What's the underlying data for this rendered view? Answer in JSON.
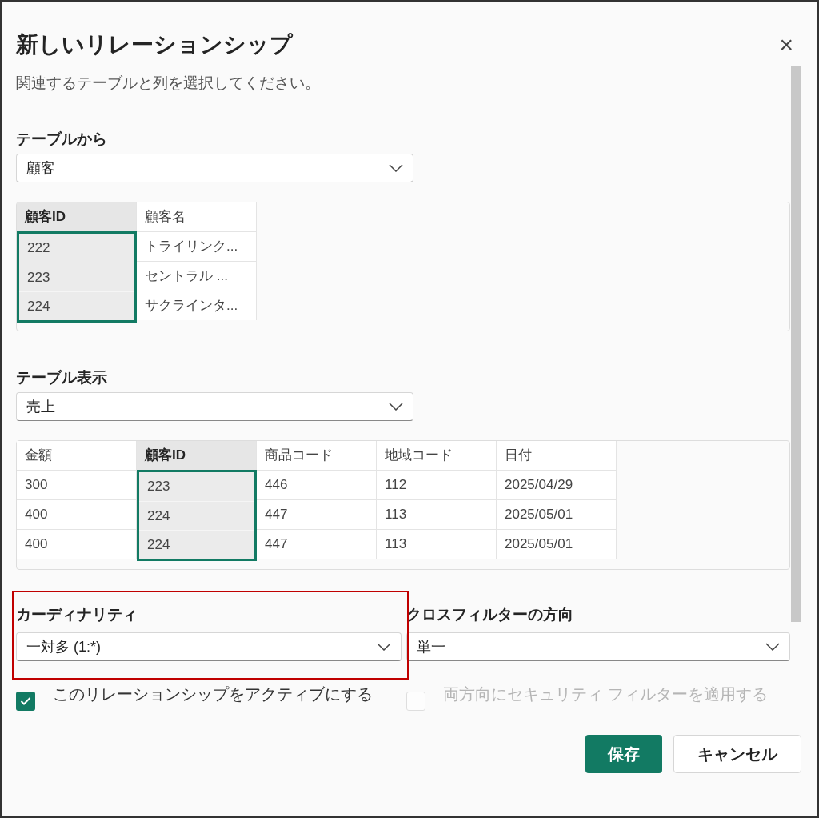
{
  "dialog": {
    "title": "新しいリレーションシップ",
    "subtitle": "関連するテーブルと列を選択してください。",
    "close": "×"
  },
  "from_table": {
    "label": "テーブルから",
    "dropdown": "顧客",
    "columns": [
      {
        "name": "顧客ID",
        "selected": true
      },
      {
        "name": "顧客名",
        "selected": false
      }
    ],
    "rows": [
      [
        "222",
        "トライリンク..."
      ],
      [
        "223",
        "セントラル ..."
      ],
      [
        "224",
        "サクラインタ..."
      ]
    ]
  },
  "to_table": {
    "label": "テーブル表示",
    "dropdown": "売上",
    "columns": [
      {
        "name": "金額",
        "selected": false
      },
      {
        "name": "顧客ID",
        "selected": true
      },
      {
        "name": "商品コード",
        "selected": false
      },
      {
        "name": "地域コード",
        "selected": false
      },
      {
        "name": "日付",
        "selected": false
      }
    ],
    "rows": [
      [
        "300",
        "223",
        "446",
        "112",
        "2025/04/29"
      ],
      [
        "400",
        "224",
        "447",
        "113",
        "2025/05/01"
      ],
      [
        "400",
        "224",
        "447",
        "113",
        "2025/05/01"
      ]
    ]
  },
  "cardinality": {
    "label": "カーディナリティ",
    "value": "一対多 (1:*)",
    "highlighted": true
  },
  "cross_filter": {
    "label": "クロスフィルターの方向",
    "value": "単一"
  },
  "options": [
    {
      "label": "このリレーションシップをアクティブにする",
      "checked": true,
      "disabled": false
    },
    {
      "label": "両方向にセキュリティ フィルターを適用する",
      "checked": false,
      "disabled": true
    }
  ],
  "buttons": [
    {
      "label": "保存",
      "kind": "primary"
    },
    {
      "label": "キャンセル",
      "kind": "secondary"
    }
  ]
}
